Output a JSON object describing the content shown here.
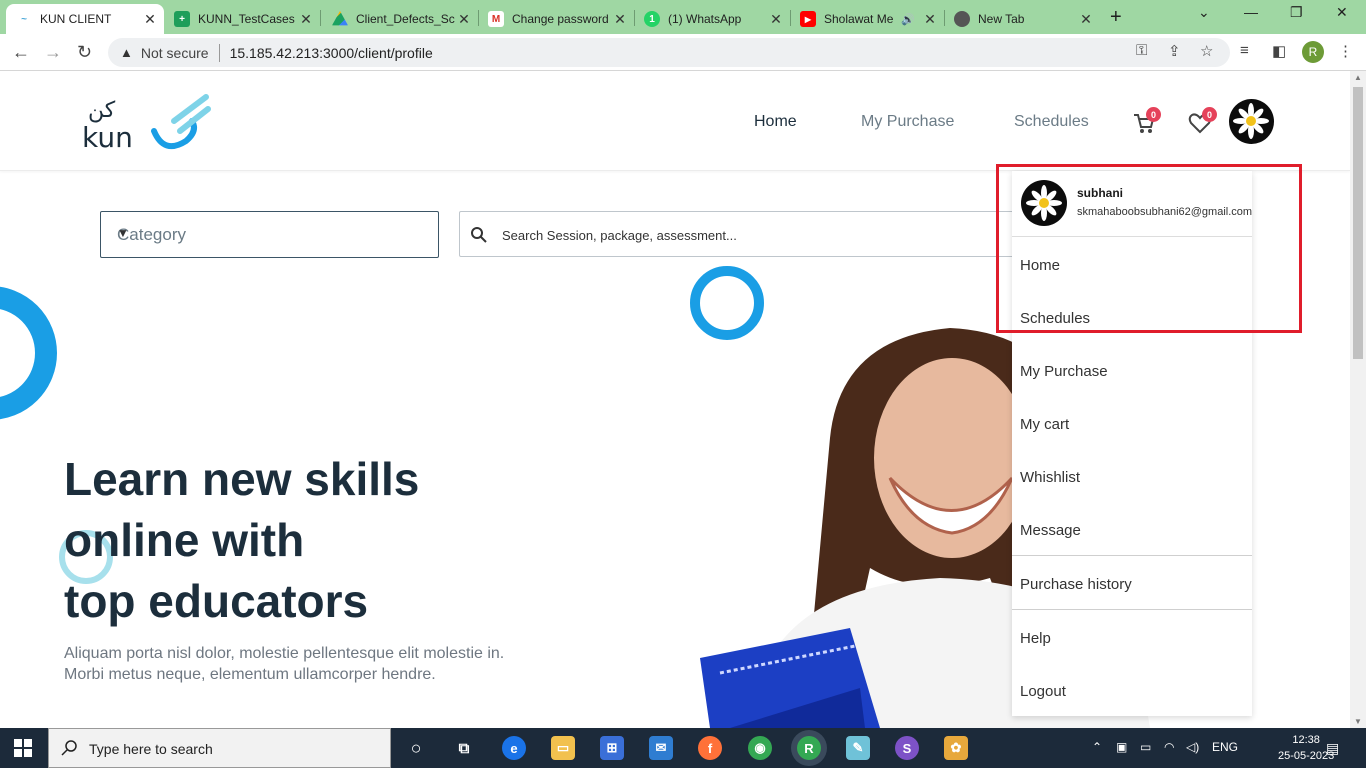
{
  "browser": {
    "tabs": [
      {
        "label": "KUN CLIENT",
        "icon": "kun-icon",
        "active": true
      },
      {
        "label": "KUNN_TestCases",
        "icon": "sheets-icon"
      },
      {
        "label": "Client_Defects_Sc",
        "icon": "drive-icon"
      },
      {
        "label": "Change password",
        "icon": "gmail-icon"
      },
      {
        "label": "(1) WhatsApp",
        "icon": "whatsapp-icon"
      },
      {
        "label": "Sholawat Me",
        "icon": "youtube-icon"
      },
      {
        "label": "New Tab",
        "icon": "chrome-icon"
      }
    ],
    "security_label": "Not secure",
    "url": "15.185.42.213:3000/client/profile",
    "profile_initial": "R"
  },
  "nav": {
    "home": "Home",
    "purchase": "My Purchase",
    "schedules": "Schedules",
    "cart_count": "0",
    "wishlist_count": "0"
  },
  "logo": {
    "text": "kun",
    "arabic": "كن"
  },
  "filters": {
    "category_placeholder": "Category",
    "search_placeholder": "Search Session, package, assessment..."
  },
  "hero": {
    "line1": "Learn new skills",
    "line2": "online with",
    "line3": "top educators",
    "text1": "Aliquam porta nisl dolor, molestie pellentesque elit molestie in.",
    "text2": "Morbi metus neque, elementum ullamcorper hendre."
  },
  "dropdown": {
    "name": "subhani",
    "email": "skmahaboobsubhani62@gmail.com",
    "items": [
      "Home",
      "Schedules",
      "My Purchase",
      "My cart",
      "Whishlist",
      "Message",
      "Purchase history",
      "Help",
      "Logout"
    ]
  },
  "taskbar": {
    "search": "Type here to search",
    "lang": "ENG",
    "time": "12:38",
    "date": "25-05-2023"
  },
  "colors": {
    "brand_blue": "#1a9ee5",
    "accent_teal": "#7ed3e8",
    "badge_red": "#e5425a",
    "highlight_red": "#e01d2b"
  }
}
